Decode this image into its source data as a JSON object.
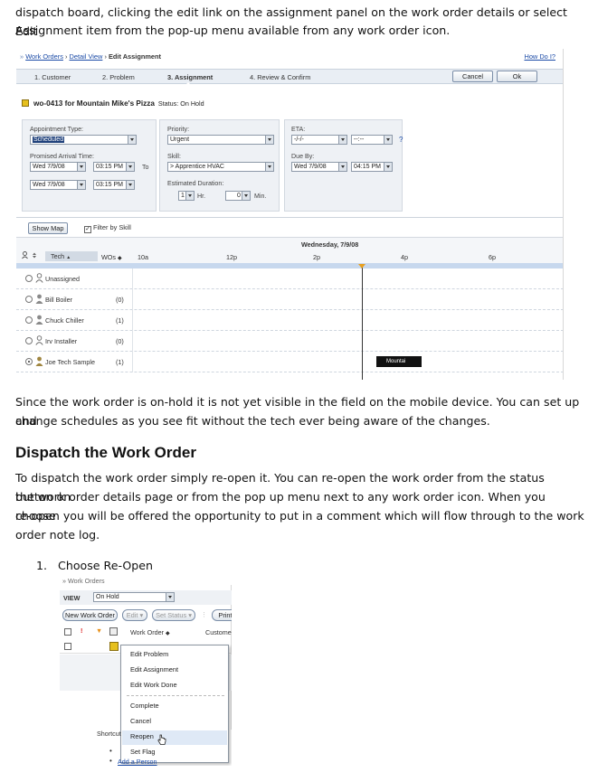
{
  "intro": {
    "line1": "dispatch board, clicking the edit link on the assignment panel on the work order details or select Edit",
    "line2": "Assignment item from the pop-up menu available from any work order icon."
  },
  "screenshot1": {
    "breadcrumb": {
      "prefix": "»",
      "link1": "Work Orders",
      "sep": "›",
      "link2": "Detail View",
      "current": "Edit Assignment"
    },
    "help_link": "How Do I?",
    "steps": [
      "1. Customer",
      "2. Problem",
      "3. Assignment",
      "4. Review & Confirm"
    ],
    "active_step_index": 2,
    "cancel_label": "Cancel",
    "ok_label": "Ok",
    "work_order": {
      "title": "wo-0413 for Mountain Mike's Pizza",
      "status": "Status: On Hold",
      "icon": "yellow-square-icon"
    },
    "appointment": {
      "type_label": "Appointment Type:",
      "type_value": "Scheduled",
      "arrival_label": "Promised Arrival Time:",
      "arrival_date1": "Wed 7/9/08",
      "arrival_time1": "03:15 PM",
      "to_label": "To",
      "arrival_date2": "Wed 7/9/08",
      "arrival_time2": "03:15 PM"
    },
    "priority": {
      "priority_label": "Priority:",
      "priority_value": "Urgent",
      "skill_label": "Skill:",
      "skill_value": "> Apprentice HVAC",
      "duration_label": "Estimated Duration:",
      "hours_value": "1",
      "hr_label": "Hr.",
      "minutes_value": "0",
      "min_label": "Min."
    },
    "eta": {
      "eta_label": "ETA:",
      "eta_date": "-/-/-",
      "eta_time": "--:--",
      "help": "?",
      "due_label": "Due By:",
      "due_date": "Wed 7/9/08",
      "due_time": "04:15 PM"
    },
    "show_map_label": "Show Map",
    "filter_label": "Filter by Skill",
    "filter_checked": true,
    "timeline": {
      "date": "Wednesday, 7/9/08",
      "tech_header": "Tech",
      "wos_header": "WOs",
      "hours": [
        "10a",
        "12p",
        "2p",
        "4p",
        "6p"
      ],
      "technicians": [
        {
          "name": "Unassigned",
          "count": "",
          "selected": false
        },
        {
          "name": "Bill Boiler",
          "count": "(0)",
          "selected": false
        },
        {
          "name": "Chuck Chiller",
          "count": "(1)",
          "selected": false
        },
        {
          "name": "Irv Installer",
          "count": "(0)",
          "selected": false
        },
        {
          "name": "Joe Tech Sample",
          "count": "(1)",
          "selected": true
        }
      ],
      "appointment_label": "Mountai"
    }
  },
  "para2": {
    "line1": "Since the work order is on-hold it is not yet visible in the field on the mobile device.  You can set up and",
    "line2": "change schedules as you see fit without the tech ever being aware of the changes."
  },
  "heading": "Dispatch the Work Order",
  "para3": {
    "line1": "To dispatch the work order simply re-open it.  You can re-open the work order from the status button on",
    "line2": "the work order details page or from the pop up menu next to any work order icon.  When you choose",
    "line3": "re-open you will be offered the opportunity to put in a comment which will flow through to the work",
    "line4": "order note log."
  },
  "list_item": {
    "number": "1.",
    "text": "Choose Re-Open"
  },
  "screenshot2": {
    "breadcrumb": "» Work Orders",
    "view_label": "VIEW",
    "view_value": "On Hold",
    "new_wo_label": "New Work Order",
    "edit_label": "Edit",
    "set_status_label": "Set Status",
    "print_label": "Print",
    "col_work_order": "Work Order",
    "col_customer": "Custome",
    "menu_items": [
      "Edit Problem",
      "Edit Assignment",
      "Edit Work Done",
      "Complete",
      "Cancel",
      "Reopen",
      "Set Flag"
    ],
    "highlighted_item": "Reopen",
    "shortcut_label": "Shortcut",
    "add_person_link": "Add a Person"
  }
}
